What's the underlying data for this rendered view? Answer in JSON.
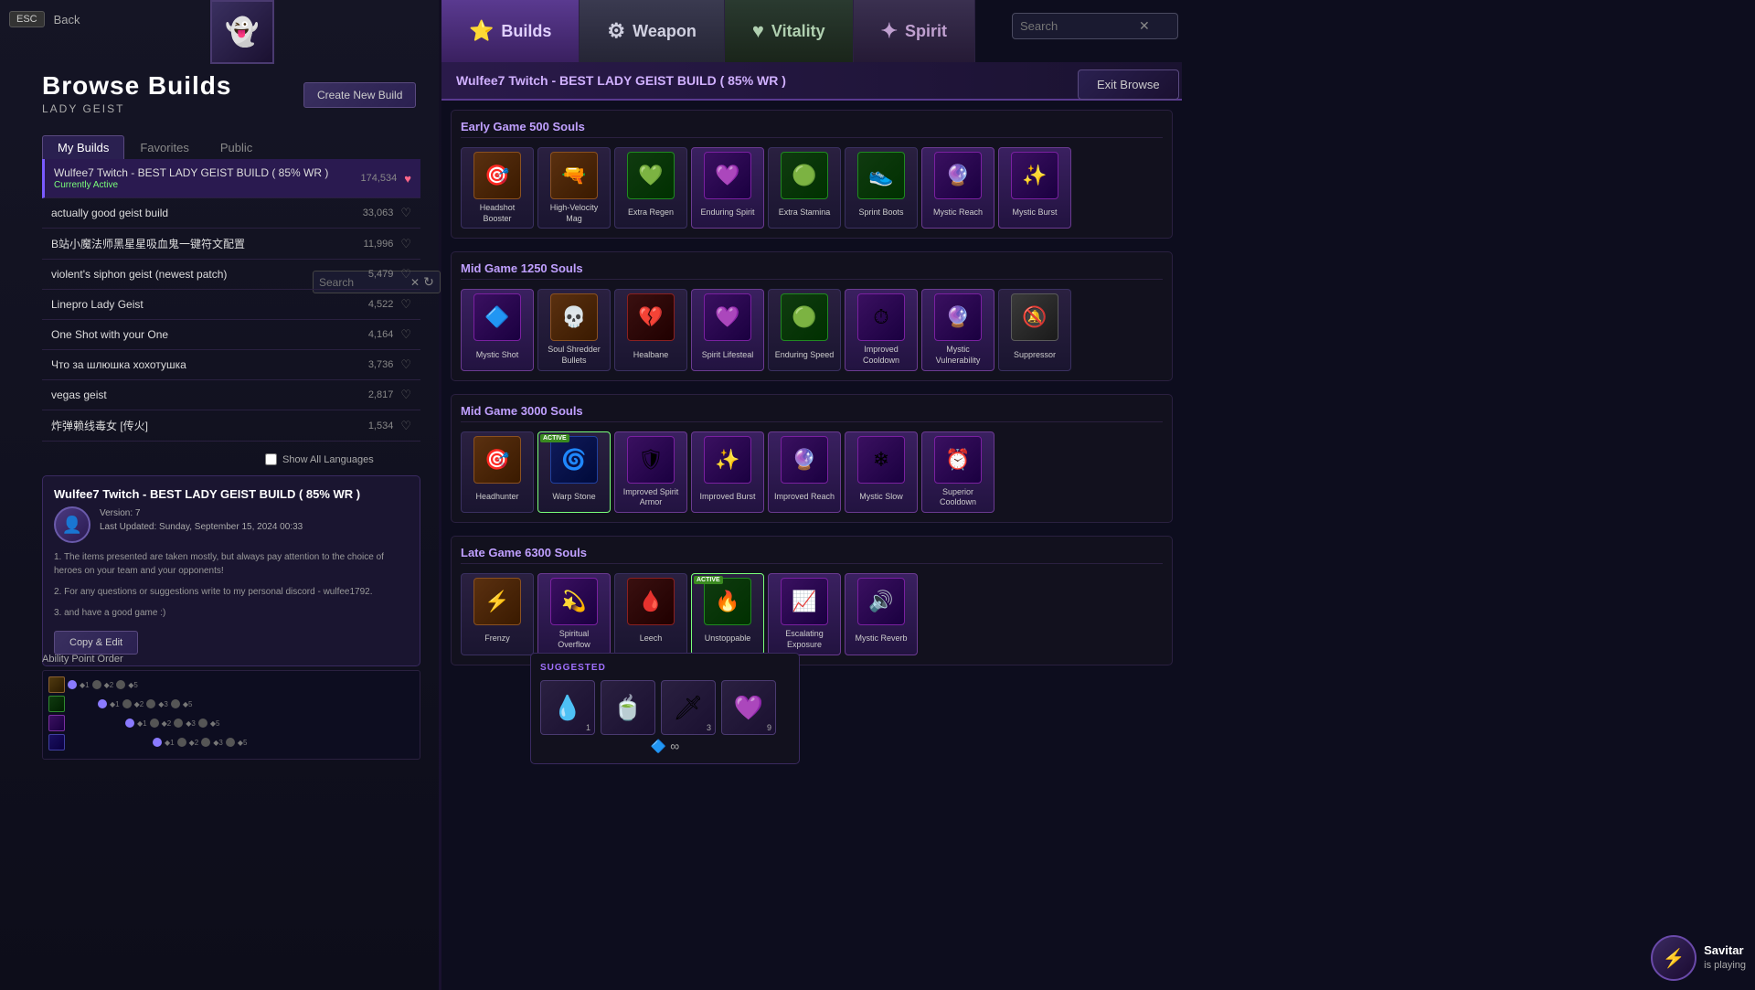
{
  "nav": {
    "esc_label": "ESC",
    "back_label": "Back"
  },
  "left": {
    "browse_title": "Browse Builds",
    "hero_name": "LADY GEIST",
    "create_btn": "Create New Build",
    "tabs": [
      "My Builds",
      "Favorites",
      "Public"
    ],
    "active_tab": 0,
    "search_placeholder": "Search",
    "show_all_lang": "Show All Languages",
    "builds": [
      {
        "name": "Wulfee7 Twitch - BEST LADY GEIST BUILD ( 85% WR )",
        "count": "174,534",
        "active": true,
        "liked": true
      },
      {
        "name": "actually good geist build",
        "count": "33,063",
        "active": false,
        "liked": false
      },
      {
        "name": "B站小魔法师黑星星吸血鬼一键符文配置",
        "count": "11,996",
        "active": false,
        "liked": false
      },
      {
        "name": "violent's siphon geist (newest patch)",
        "count": "5,479",
        "active": false,
        "liked": false
      },
      {
        "name": "Linepro Lady Geist",
        "count": "4,522",
        "active": false,
        "liked": false
      },
      {
        "name": "One Shot with your One",
        "count": "4,164",
        "active": false,
        "liked": false
      },
      {
        "name": "Что за шлюшка хохотушка",
        "count": "3,736",
        "active": false,
        "liked": false
      },
      {
        "name": "vegas geist",
        "count": "2,817",
        "active": false,
        "liked": false
      },
      {
        "name": "炸弹赖线毒女 [传火]",
        "count": "1,534",
        "active": false,
        "liked": false
      }
    ],
    "detail": {
      "title": "Wulfee7 Twitch - BEST LADY GEIST BUILD ( 85% WR )",
      "version": "Version: 7",
      "updated": "Last Updated: Sunday, September 15, 2024 00:33",
      "desc1": "1. The items presented are taken mostly, but always pay attention to the choice of heroes on your team and your opponents!",
      "desc2": "2. For any questions or suggestions write to my personal discord - wulfee1792.",
      "desc3": "3. and have a good game :)",
      "copy_edit": "Copy & Edit"
    },
    "ability_order_title": "Ability Point Order"
  },
  "right": {
    "tabs": [
      {
        "id": "builds",
        "icon": "⭐",
        "label": "Builds"
      },
      {
        "id": "weapon",
        "icon": "⚙",
        "label": "Weapon"
      },
      {
        "id": "vitality",
        "icon": "♥",
        "label": "Vitality"
      },
      {
        "id": "spirit",
        "icon": "✦",
        "label": "Spirit"
      }
    ],
    "active_tab": "builds",
    "search_placeholder": "Search",
    "exit_browse": "Exit Browse",
    "build_title": "Wulfee7 Twitch - BEST LADY GEIST BUILD ( 85% WR )",
    "sections": [
      {
        "title": "Early Game 500 Souls",
        "items": [
          {
            "name": "Headshot Booster",
            "icon": "🎯",
            "color": "orange",
            "active": false
          },
          {
            "name": "High-Velocity Mag",
            "icon": "🔫",
            "color": "orange",
            "active": false
          },
          {
            "name": "Extra Regen",
            "icon": "💚",
            "color": "green",
            "active": false
          },
          {
            "name": "Enduring Spirit",
            "icon": "💜",
            "color": "purple",
            "active": false
          },
          {
            "name": "Extra Stamina",
            "icon": "🟢",
            "color": "green",
            "active": false
          },
          {
            "name": "Sprint Boots",
            "icon": "👟",
            "color": "green",
            "active": false
          },
          {
            "name": "Mystic Reach",
            "icon": "🔮",
            "color": "purple",
            "active": false
          },
          {
            "name": "Mystic Burst",
            "icon": "✨",
            "color": "purple",
            "active": false
          }
        ]
      },
      {
        "title": "Mid Game 1250 Souls",
        "items": [
          {
            "name": "Mystic Shot",
            "icon": "🔷",
            "color": "purple",
            "active": false
          },
          {
            "name": "Soul Shredder Bullets",
            "icon": "💀",
            "color": "orange",
            "active": false
          },
          {
            "name": "Healbane",
            "icon": "💔",
            "color": "red",
            "active": false
          },
          {
            "name": "Spirit Lifesteal",
            "icon": "💜",
            "color": "purple",
            "active": false
          },
          {
            "name": "Enduring Speed",
            "icon": "🟢",
            "color": "green",
            "active": false
          },
          {
            "name": "Improved Cooldown",
            "icon": "⏱",
            "color": "purple",
            "active": false
          },
          {
            "name": "Mystic Vulnerability",
            "icon": "🔮",
            "color": "purple",
            "active": false
          },
          {
            "name": "Suppressor",
            "icon": "🔕",
            "color": "gray",
            "active": false
          }
        ]
      },
      {
        "title": "Mid Game 3000 Souls",
        "items": [
          {
            "name": "Headhunter",
            "icon": "🎯",
            "color": "orange",
            "active": false
          },
          {
            "name": "Warp Stone",
            "icon": "🌀",
            "color": "blue",
            "active": true
          },
          {
            "name": "Improved Spirit Armor",
            "icon": "🛡",
            "color": "purple",
            "active": false
          },
          {
            "name": "Improved Burst",
            "icon": "✨",
            "color": "purple",
            "active": false
          },
          {
            "name": "Improved Reach",
            "icon": "🔮",
            "color": "purple",
            "active": false
          },
          {
            "name": "Mystic Slow",
            "icon": "❄",
            "color": "purple",
            "active": false
          },
          {
            "name": "Superior Cooldown",
            "icon": "⏰",
            "color": "purple",
            "active": false
          }
        ]
      },
      {
        "title": "Late Game 6300 Souls",
        "items": [
          {
            "name": "Frenzy",
            "icon": "⚡",
            "color": "orange",
            "active": false
          },
          {
            "name": "Spiritual Overflow",
            "icon": "💫",
            "color": "purple",
            "active": false
          },
          {
            "name": "Leech",
            "icon": "🩸",
            "color": "red",
            "active": false
          },
          {
            "name": "Unstoppable",
            "icon": "🔥",
            "color": "green",
            "active": true
          },
          {
            "name": "Escalating Exposure",
            "icon": "📈",
            "color": "purple",
            "active": false
          },
          {
            "name": "Mystic Reverb",
            "icon": "🔊",
            "color": "purple",
            "active": false
          }
        ]
      }
    ],
    "suggested": {
      "label": "SUGGESTED",
      "items": [
        {
          "icon": "💧",
          "num": "1"
        },
        {
          "icon": "🍵",
          "num": ""
        },
        {
          "icon": "🗡",
          "num": "3"
        },
        {
          "icon": "💜",
          "num": "9"
        }
      ]
    },
    "player": {
      "name": "Savitar",
      "status": "is playing",
      "icon": "⚡"
    }
  }
}
